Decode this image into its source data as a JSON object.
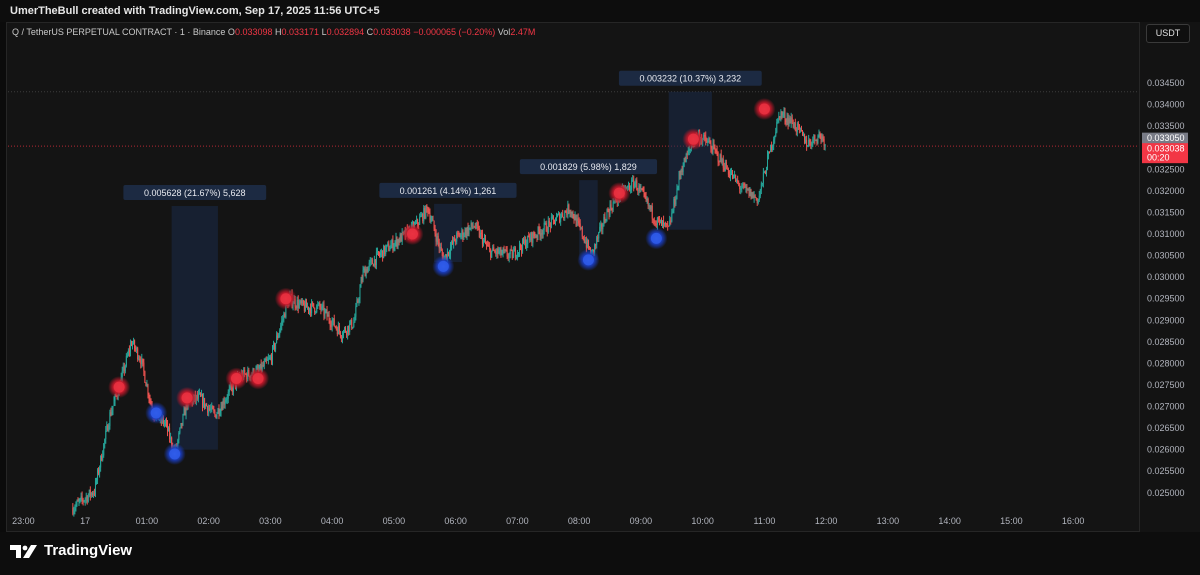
{
  "header": {
    "created_by": "UmerTheBull created with TradingView.com, Sep 17, 2025 11:56 UTC+5"
  },
  "symbol_line": {
    "symbol": "Q / TetherUS PERPETUAL CONTRACT · 1 · Binance",
    "o_label": "O",
    "o_value": "0.033098",
    "h_label": "H",
    "h_value": "0.033171",
    "l_label": "L",
    "l_value": "0.032894",
    "c_label": "C",
    "c_value": "0.033038",
    "change": "−0.000065 (−0.20%)",
    "vol_label": "Vol",
    "vol_value": "2.47M"
  },
  "unit_button": "USDT",
  "footer": {
    "brand": "TradingView"
  },
  "colors": {
    "up": "#26a69a",
    "down": "#ef5350",
    "marker_red": "#e0303e",
    "marker_blue": "#2a55d8",
    "range_fill": "#1a2a48",
    "price_tag": "#f23645"
  },
  "chart_data": {
    "type": "candlestick",
    "ylim": [
      0.0246,
      0.0355
    ],
    "y_ticks": [
      "0.025000",
      "0.025500",
      "0.026000",
      "0.026500",
      "0.027000",
      "0.027500",
      "0.028000",
      "0.028500",
      "0.029000",
      "0.029500",
      "0.030000",
      "0.030500",
      "0.031000",
      "0.031500",
      "0.032000",
      "0.032500",
      "0.033000",
      "0.033500",
      "0.034000",
      "0.034500"
    ],
    "x_ticks": [
      "23:00",
      "17",
      "01:00",
      "02:00",
      "03:00",
      "04:00",
      "05:00",
      "06:00",
      "07:00",
      "08:00",
      "09:00",
      "10:00",
      "11:00",
      "12:00",
      "13:00",
      "14:00",
      "15:00",
      "16:00"
    ],
    "x_tick_hours": [
      -1,
      0,
      1,
      2,
      3,
      4,
      5,
      6,
      7,
      8,
      9,
      10,
      11,
      12,
      13,
      14,
      15,
      16
    ],
    "xlim_hours": [
      -1.25,
      17.05
    ],
    "price_path": [
      [
        -0.2,
        0.02465
      ],
      [
        0.15,
        0.02505
      ],
      [
        0.4,
        0.0268
      ],
      [
        0.55,
        0.02745
      ],
      [
        0.75,
        0.0285
      ],
      [
        0.9,
        0.0281
      ],
      [
        1.1,
        0.02685
      ],
      [
        1.3,
        0.0266
      ],
      [
        1.45,
        0.0259
      ],
      [
        1.65,
        0.0271
      ],
      [
        1.85,
        0.0272
      ],
      [
        2.1,
        0.0268
      ],
      [
        2.5,
        0.0277
      ],
      [
        2.8,
        0.0278
      ],
      [
        3.0,
        0.0281
      ],
      [
        3.3,
        0.0295
      ],
      [
        3.55,
        0.0293
      ],
      [
        3.8,
        0.0293
      ],
      [
        4.15,
        0.0287
      ],
      [
        4.35,
        0.02895
      ],
      [
        4.5,
        0.0301
      ],
      [
        4.75,
        0.0305
      ],
      [
        5.1,
        0.0309
      ],
      [
        5.3,
        0.0311
      ],
      [
        5.55,
        0.0316
      ],
      [
        5.8,
        0.0304
      ],
      [
        6.0,
        0.0309
      ],
      [
        6.3,
        0.0312
      ],
      [
        6.55,
        0.0306
      ],
      [
        6.9,
        0.0305
      ],
      [
        7.2,
        0.0309
      ],
      [
        7.5,
        0.0312
      ],
      [
        7.85,
        0.0316
      ],
      [
        8.05,
        0.031
      ],
      [
        8.2,
        0.0305
      ],
      [
        8.45,
        0.0315
      ],
      [
        8.65,
        0.0319
      ],
      [
        8.9,
        0.0322
      ],
      [
        9.1,
        0.0317
      ],
      [
        9.25,
        0.0313
      ],
      [
        9.45,
        0.0311
      ],
      [
        9.65,
        0.0325
      ],
      [
        9.9,
        0.0333
      ],
      [
        10.1,
        0.0331
      ],
      [
        10.4,
        0.0325
      ],
      [
        10.6,
        0.0321
      ],
      [
        10.9,
        0.0318
      ],
      [
        11.05,
        0.0327
      ],
      [
        11.25,
        0.0338
      ],
      [
        11.45,
        0.0336
      ],
      [
        11.7,
        0.0331
      ],
      [
        11.9,
        0.0333
      ],
      [
        12.0,
        0.0331
      ]
    ],
    "markers": [
      {
        "color": "red",
        "x": 0.55,
        "y": 0.02745
      },
      {
        "color": "blue",
        "x": 1.15,
        "y": 0.02685
      },
      {
        "color": "blue",
        "x": 1.45,
        "y": 0.0259
      },
      {
        "color": "red",
        "x": 1.65,
        "y": 0.0272
      },
      {
        "color": "red",
        "x": 2.45,
        "y": 0.02765
      },
      {
        "color": "red",
        "x": 2.8,
        "y": 0.02765
      },
      {
        "color": "red",
        "x": 3.25,
        "y": 0.0295
      },
      {
        "color": "red",
        "x": 5.3,
        "y": 0.031
      },
      {
        "color": "blue",
        "x": 5.8,
        "y": 0.03025
      },
      {
        "color": "blue",
        "x": 8.15,
        "y": 0.0304
      },
      {
        "color": "red",
        "x": 8.65,
        "y": 0.03195
      },
      {
        "color": "blue",
        "x": 9.25,
        "y": 0.0309
      },
      {
        "color": "red",
        "x": 9.85,
        "y": 0.0332
      },
      {
        "color": "red",
        "x": 11.0,
        "y": 0.0339
      }
    ],
    "ranges": [
      {
        "x0": 1.4,
        "x1": 2.15,
        "y0": 0.026,
        "y1": 0.03165,
        "label": "0.005628 (21.67%) 5,628"
      },
      {
        "x0": 5.65,
        "x1": 6.1,
        "y0": 0.03035,
        "y1": 0.0317,
        "label": "0.001261 (4.14%) 1,261"
      },
      {
        "x0": 8.0,
        "x1": 8.3,
        "y0": 0.0304,
        "y1": 0.03225,
        "label": "0.001829 (5.98%) 1,829"
      },
      {
        "x0": 9.45,
        "x1": 10.15,
        "y0": 0.0311,
        "y1": 0.0343,
        "label": "0.003232 (10.37%) 3,232"
      }
    ],
    "last_price": {
      "value": 0.033038,
      "label": "0.033038",
      "time": "00:20"
    },
    "marked_price": {
      "value": 0.03305,
      "label": "0.033050"
    },
    "high_line": 0.0343,
    "last_candle_hour": 12.0
  }
}
